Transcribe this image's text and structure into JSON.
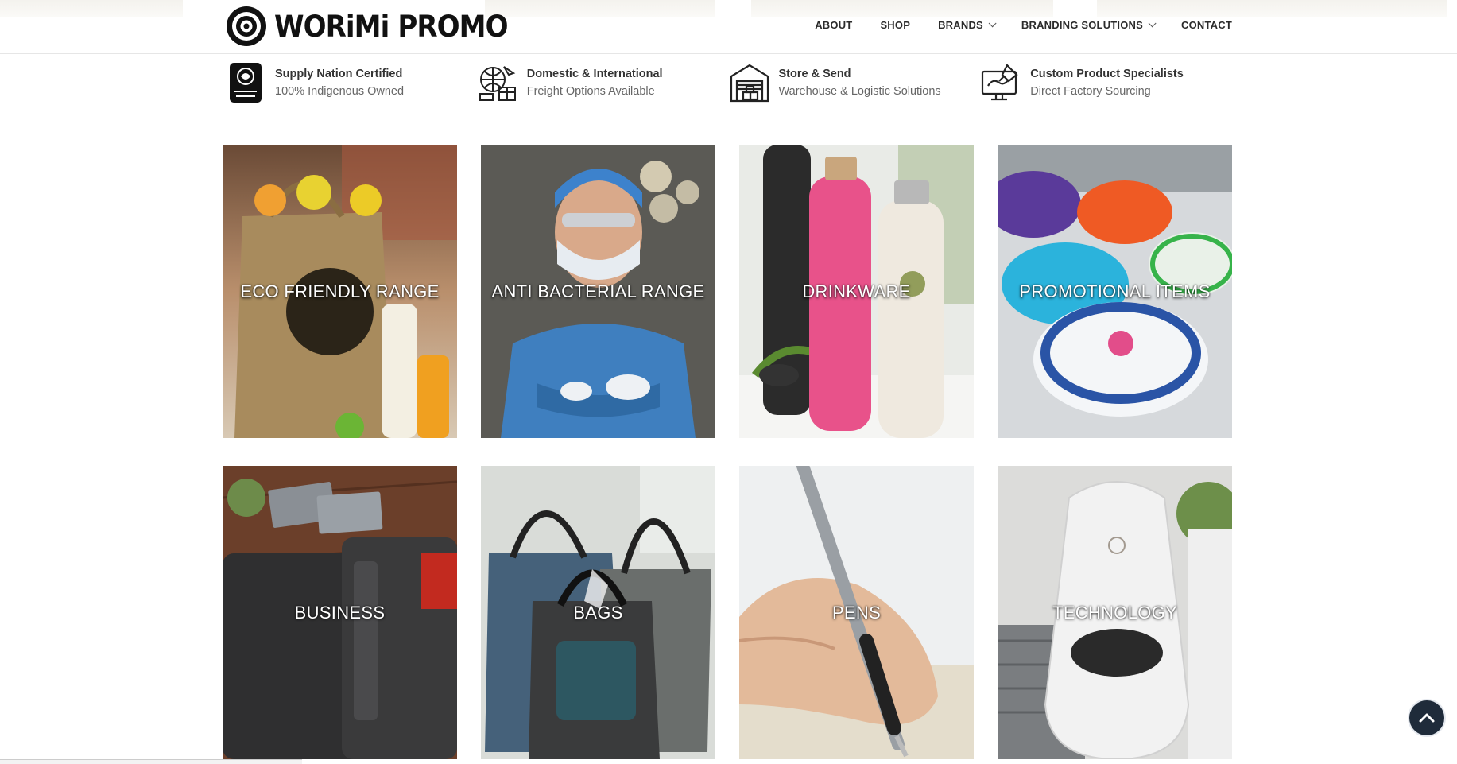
{
  "header": {
    "brand": "WORiMi PROMO",
    "nav": [
      {
        "label": "ABOUT",
        "dropdown": false
      },
      {
        "label": "SHOP",
        "dropdown": false
      },
      {
        "label": "BRANDS",
        "dropdown": true
      },
      {
        "label": "BRANDING SOLUTIONS",
        "dropdown": true
      },
      {
        "label": "CONTACT",
        "dropdown": false
      }
    ]
  },
  "features": [
    {
      "icon": "supply-nation-badge-icon",
      "title": "Supply Nation Certified",
      "subtitle": "100% Indigenous Owned"
    },
    {
      "icon": "freight-globe-icon",
      "title": "Domestic & International",
      "subtitle": "Freight Options Available"
    },
    {
      "icon": "warehouse-icon",
      "title": "Store & Send",
      "subtitle": "Warehouse & Logistic Solutions"
    },
    {
      "icon": "computer-design-icon",
      "title": "Custom Product Specialists",
      "subtitle": "Direct Factory Sourcing"
    }
  ],
  "categories": [
    {
      "label": "ECO FRIENDLY RANGE"
    },
    {
      "label": "ANTI BACTERIAL RANGE"
    },
    {
      "label": "DRINKWARE"
    },
    {
      "label": "PROMOTIONAL ITEMS"
    },
    {
      "label": "BUSINESS"
    },
    {
      "label": "BAGS"
    },
    {
      "label": "PENS"
    },
    {
      "label": "TECHNOLOGY"
    }
  ],
  "scroll_top": {
    "icon": "chevron-up-icon"
  },
  "colors": {
    "scroll_button": "#1f2b3a",
    "nav_text": "#2b2b2b"
  }
}
